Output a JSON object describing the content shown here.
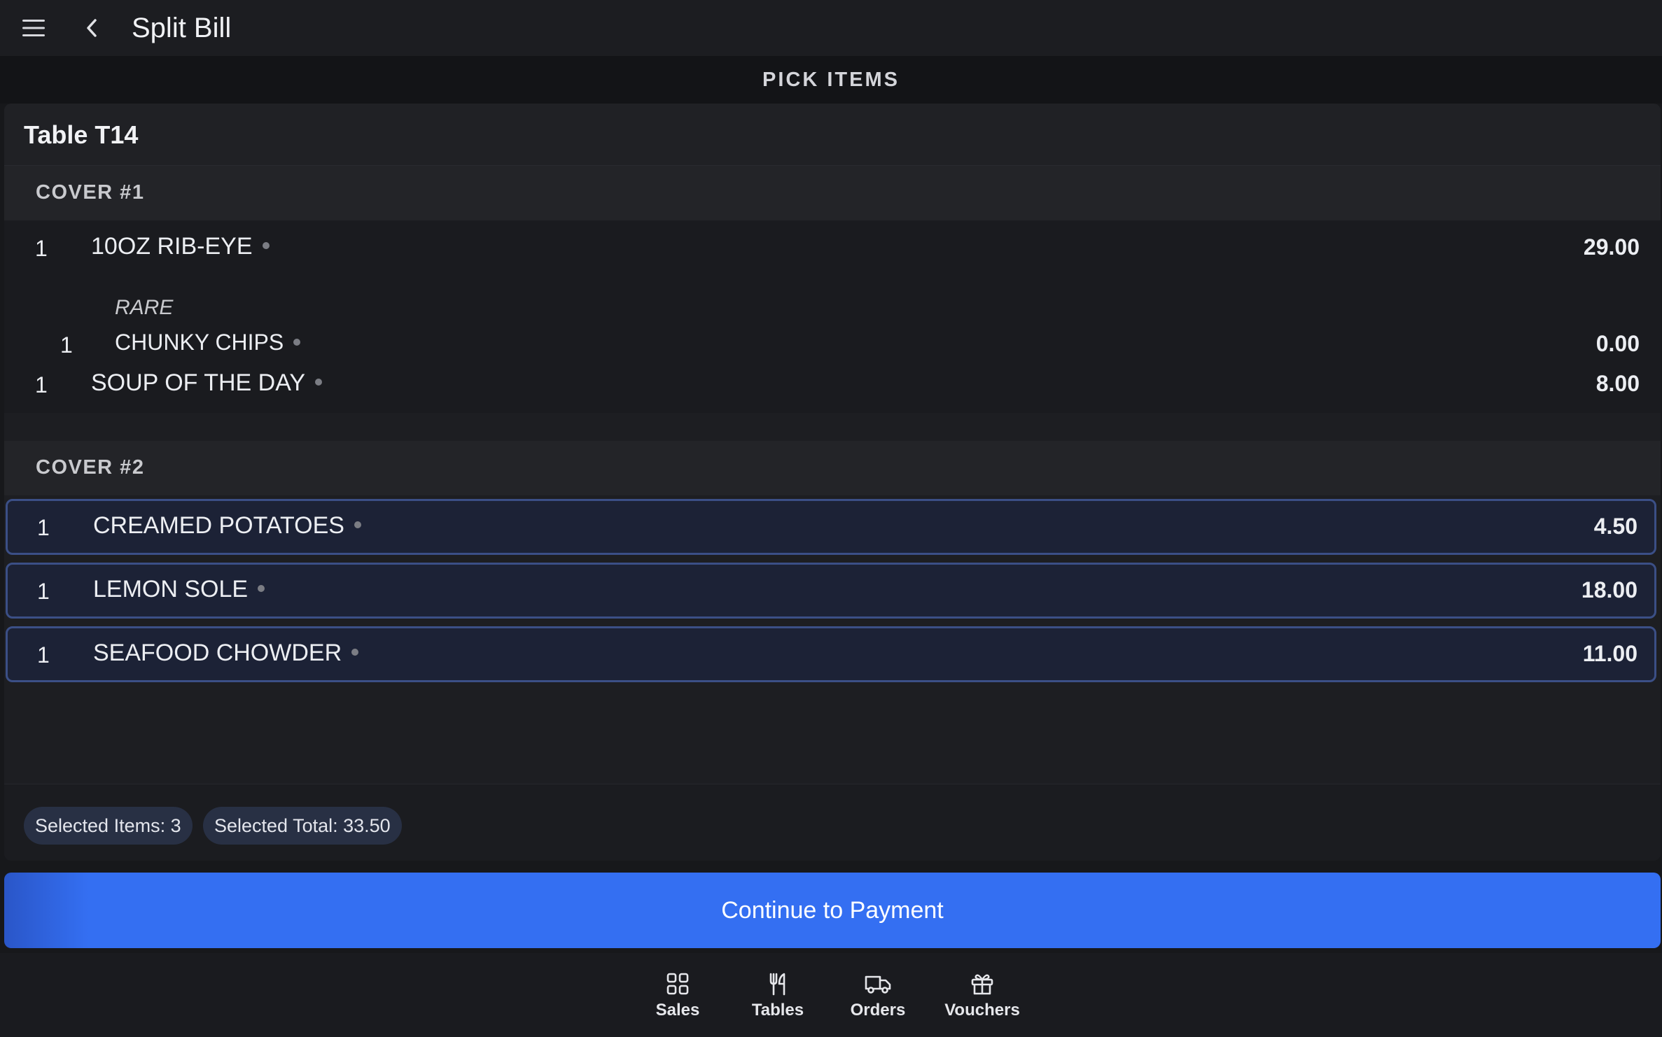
{
  "header": {
    "title": "Split Bill",
    "section_title": "PICK ITEMS"
  },
  "table": {
    "name": "Table T14"
  },
  "covers": [
    {
      "label": "COVER #1",
      "items": [
        {
          "qty": "1",
          "name": "10OZ RIB-EYE",
          "price": "29.00"
        },
        {
          "modifier": "RARE"
        },
        {
          "qty": "1",
          "name": "CHUNKY CHIPS",
          "price": "0.00"
        },
        {
          "qty": "1",
          "name": "SOUP OF THE DAY",
          "price": "8.00"
        }
      ]
    },
    {
      "label": "COVER #2",
      "items": [
        {
          "qty": "1",
          "name": "CREAMED POTATOES",
          "price": "4.50",
          "selected": true
        },
        {
          "qty": "1",
          "name": "LEMON SOLE",
          "price": "18.00",
          "selected": true
        },
        {
          "qty": "1",
          "name": "SEAFOOD CHOWDER",
          "price": "11.00",
          "selected": true
        }
      ]
    }
  ],
  "summary": {
    "selected_items": "Selected Items: 3",
    "selected_total": "Selected Total: 33.50"
  },
  "actions": {
    "continue_label": "Continue to Payment"
  },
  "nav": [
    {
      "label": "Sales",
      "icon": "grid-icon"
    },
    {
      "label": "Tables",
      "icon": "cutlery-icon"
    },
    {
      "label": "Orders",
      "icon": "delivery-truck-icon"
    },
    {
      "label": "Vouchers",
      "icon": "gift-icon"
    }
  ],
  "colors": {
    "accent": "#346ff2",
    "selected_border": "#3b4f86",
    "background": "#17181b"
  }
}
